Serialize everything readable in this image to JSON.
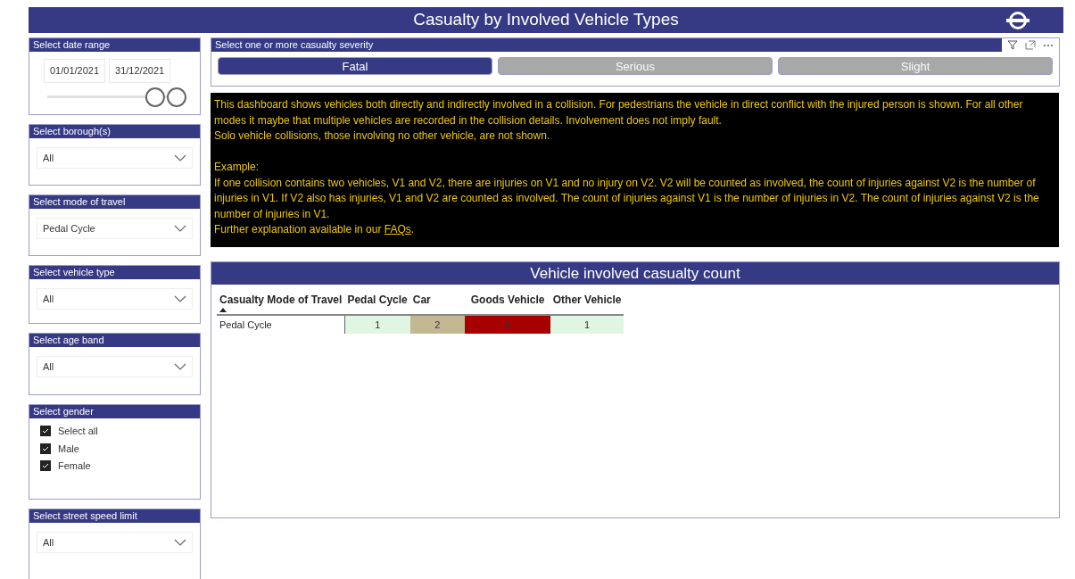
{
  "header": {
    "title": "Casualty by Involved Vehicle Types"
  },
  "slicers": [
    {
      "kind": "daterange",
      "title": "Select date range",
      "from": "01/01/2021",
      "to": "31/12/2021",
      "handles": [
        {
          "level": 0.82
        },
        {
          "level": 1
        }
      ]
    },
    {
      "kind": "dropdown",
      "title": "Select borough(s)",
      "value": "All"
    },
    {
      "kind": "dropdown",
      "title": "Select mode of travel",
      "value": "Pedal Cycle"
    },
    {
      "kind": "dropdown",
      "title": "Select vehicle type",
      "value": "All"
    },
    {
      "kind": "dropdown",
      "title": "Select age band",
      "value": "All"
    },
    {
      "kind": "checklist",
      "title": "Select gender",
      "options": [
        {
          "label": "Select all",
          "checked": true
        },
        {
          "label": "Male",
          "checked": true
        },
        {
          "label": "Female",
          "checked": true
        }
      ]
    },
    {
      "kind": "dropdown",
      "title": "Select street speed limit",
      "value": "All"
    }
  ],
  "severity": {
    "title": "Select one or more casualty severity",
    "options": [
      {
        "label": "Fatal",
        "selected": true
      },
      {
        "label": "Serious",
        "selected": false
      },
      {
        "label": "Slight",
        "selected": false
      }
    ]
  },
  "explanation": {
    "paragraphs": [
      "This dashboard shows vehicles both directly and indirectly involved in a collision.  For pedestrians the vehicle in direct conflict with the injured person is shown. For all other modes it maybe that multiple vehicles are recorded in the collision details. Involvement does not imply fault.",
      "Solo vehicle collisions, those involving no other vehicle, are not shown.",
      "Example:",
      "If one collision contains two vehicles, V1 and V2, there are injuries on V1 and no injury on V2. V2 will be counted as involved, the count of injuries against V2 is the number of injuries in V1. If V2 also has injuries, V1 and V2 are counted as involved. The count of injuries against V1 is the number of injuries in V2. The count of injuries against V2 is the number of injuries in V1."
    ],
    "last_line": "Further explanation available in our ",
    "link": "FAQs",
    "after_link": "."
  },
  "table": {
    "title": "Vehicle involved casualty count",
    "columns": [
      "Casualty Mode of Travel",
      "Pedal Cycle",
      "Car",
      "Goods Vehicle",
      "Other Vehicle"
    ],
    "rows": [
      {
        "cells": [
          {
            "value": "Pedal Cycle"
          },
          {
            "value": "1",
            "color": "#e1f5e3"
          },
          {
            "value": "2",
            "color": "#c2b993"
          },
          {
            "value": "6",
            "color": "#a80000"
          },
          {
            "value": "1",
            "color": "#e1f5e3"
          }
        ]
      }
    ]
  }
}
